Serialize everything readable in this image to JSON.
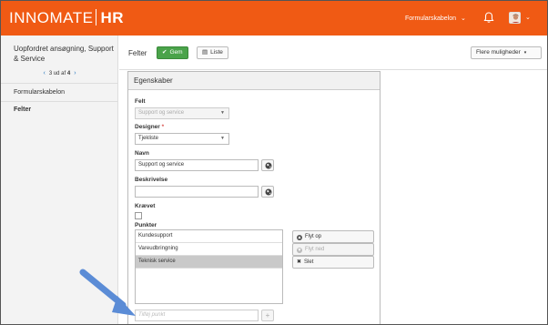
{
  "app": {
    "brand": "INNOMATE",
    "brand_suffix": "HR"
  },
  "topbar": {
    "menu_label": "Formularskabelon",
    "accent": "#f05a14"
  },
  "sidebar": {
    "title": "Uopfordret ansøgning, Support & Service",
    "pager_text": "3 ud af",
    "pager_total": "4",
    "items": [
      {
        "label": "Formularskabelon"
      },
      {
        "label": "Felter"
      }
    ]
  },
  "toolbar": {
    "section_title": "Felter",
    "save_label": "Gem",
    "list_label": "Liste",
    "more_label": "Flere muligheder"
  },
  "panel": {
    "title": "Egenskaber",
    "felt_label": "Felt",
    "felt_value": "Support og service",
    "designer_label": "Designer",
    "designer_value": "Tjekliste",
    "navn_label": "Navn",
    "navn_value": "Support og service",
    "beskrivelse_label": "Beskrivelse",
    "beskrivelse_value": "",
    "kraevet_label": "Krævet",
    "punkter_label": "Punkter",
    "punkter": [
      {
        "label": "Kundesupport"
      },
      {
        "label": "Vareudbringning"
      },
      {
        "label": "Teknisk service"
      }
    ],
    "move_up_label": "Flyt op",
    "move_down_label": "Flyt ned",
    "delete_label": "Slet",
    "add_placeholder": "Tilføj punkt"
  }
}
